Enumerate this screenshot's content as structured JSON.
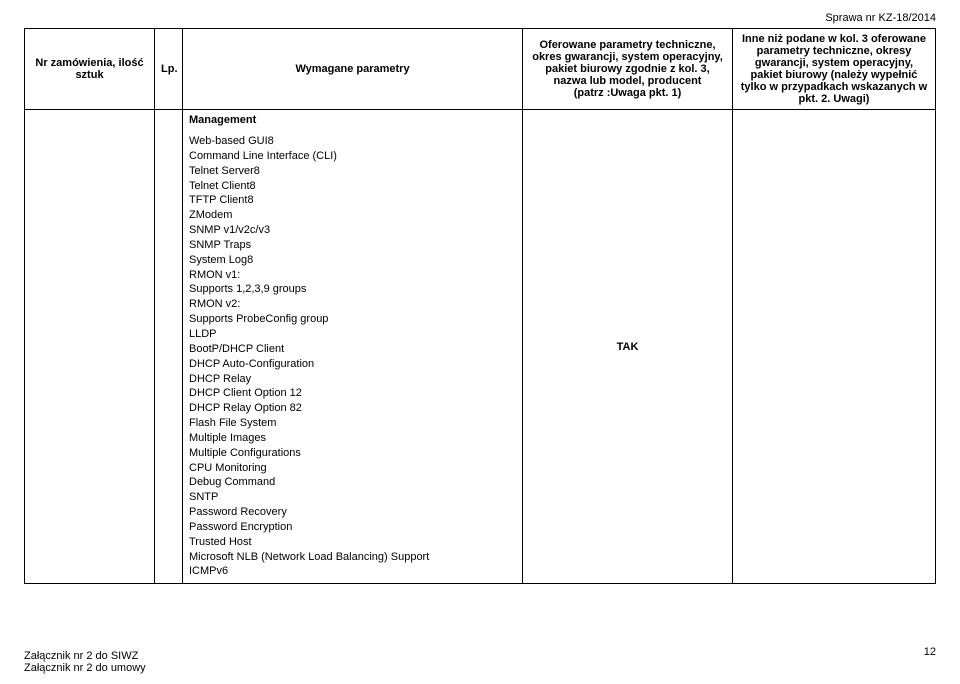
{
  "header_right": "Sprawa nr KZ-18/2014",
  "columns": {
    "c1": "Nr zamówienia, ilość sztuk",
    "c2": "Lp.",
    "c3": "Wymagane parametry",
    "c4": "Oferowane parametry techniczne, okres gwarancji, system operacyjny, pakiet biurowy zgodnie z kol. 3,\nnazwa lub model, producent\n(patrz :Uwaga pkt. 1)",
    "c5": "Inne niż podane w kol. 3 oferowane parametry techniczne, okresy gwarancji, system operacyjny, pakiet biurowy (należy wypełnić tylko w przypadkach wskazanych w pkt. 2. Uwagi)"
  },
  "row": {
    "management_label": "Management",
    "features": "Web-based GUI8\nCommand Line Interface (CLI)\nTelnet Server8\nTelnet Client8\nTFTP Client8\nZModem\nSNMP v1/v2c/v3\nSNMP Traps\nSystem Log8\nRMON v1:\nSupports 1,2,3,9 groups\nRMON v2:\nSupports ProbeConfig group\nLLDP\nBootP/DHCP Client\nDHCP Auto-Configuration\nDHCP Relay\nDHCP Client Option 12\nDHCP Relay Option 82\nFlash File System\nMultiple Images\nMultiple Configurations\nCPU Monitoring\nDebug Command\nSNTP\nPassword Recovery\nPassword Encryption\nTrusted Host\nMicrosoft NLB (Network Load Balancing) Support\nICMPv6",
    "tak": "TAK"
  },
  "footer": {
    "line1": "Załącznik nr 2 do SIWZ",
    "line2": "Załącznik nr 2 do umowy"
  },
  "page_number": "12"
}
